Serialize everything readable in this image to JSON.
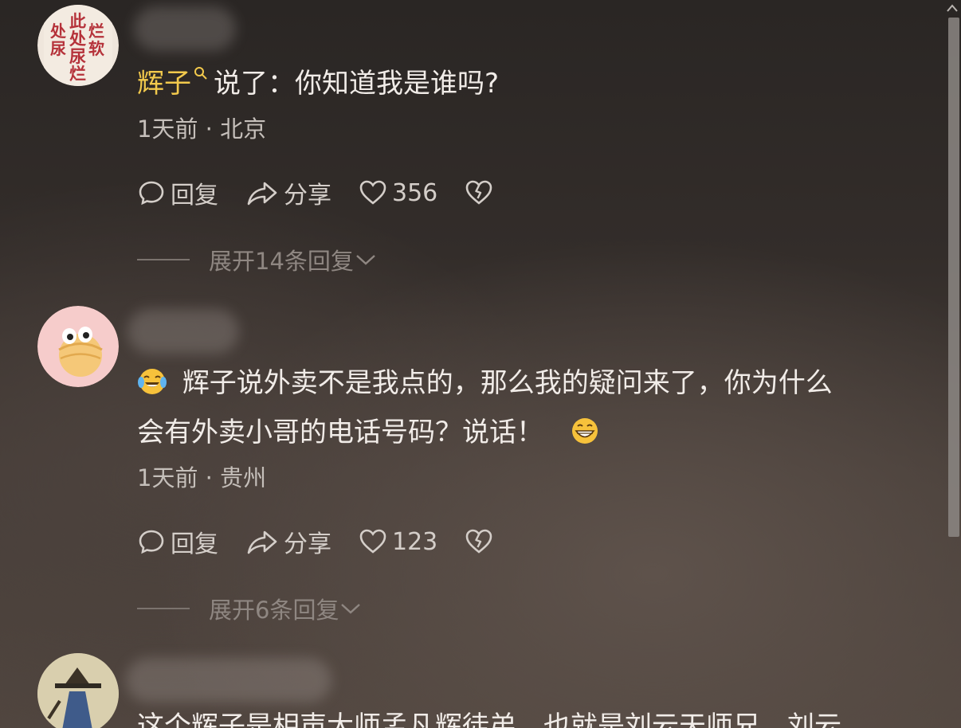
{
  "comments": [
    {
      "mention": "辉子",
      "text": "说了：你知道我是谁吗?",
      "meta": "1天前 · 北京",
      "reply_label": "回复",
      "share_label": "分享",
      "likes": "356",
      "expand_label": "展开14条回复"
    },
    {
      "line1": "辉子说外卖不是我点的，那么我的疑问来了，你为什么",
      "line2": "会有外卖小哥的电话号码？说话！",
      "meta": "1天前 · 贵州",
      "reply_label": "回复",
      "share_label": "分享",
      "likes": "123",
      "expand_label": "展开6条回复"
    },
    {
      "partial_text": "这个辉子是相声大师孟凡辉徒弟，也就是刘云天师兄，刘云"
    }
  ],
  "avatar1_text": "此处尿烂软",
  "icons": [
    "comment-icon",
    "share-icon",
    "heart-icon",
    "dislike-heart-icon",
    "chevron-down-icon",
    "search-icon",
    "tears-of-joy-emoji",
    "grin-emoji"
  ]
}
